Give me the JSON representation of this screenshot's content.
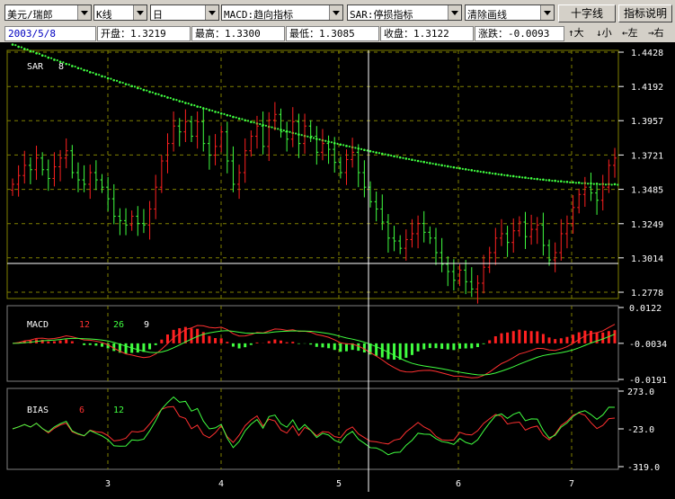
{
  "toolbar": {
    "symbol": "美元/瑞郎",
    "chart_type": "K线",
    "period": "日",
    "indicator1": "MACD:趋向指标",
    "indicator2": "SAR:停损指标",
    "draw_tool": "清除画线",
    "crosshair_btn": "十字线",
    "indicator_btn": "指标说明"
  },
  "info": {
    "date": "2003/5/8",
    "open": "开盘：1.3219",
    "high": "最高：1.3300",
    "low": "最低：1.3085",
    "close": "收盘：1.3122",
    "change": "涨跌：-0.0093",
    "nav_up": "↑大",
    "nav_down": "↓小",
    "nav_left": "←左",
    "nav_right": "→右"
  },
  "main_panel": {
    "label": "SAR",
    "param": "8",
    "y_ticks": [
      "1.4428",
      "1.4192",
      "1.3957",
      "1.3721",
      "1.3485",
      "1.3249",
      "1.3014",
      "1.2778"
    ]
  },
  "macd_panel": {
    "label": "MACD",
    "p1": "12",
    "p2": "26",
    "p3": "9",
    "y_ticks": [
      "0.0122",
      "-0.0034",
      "-0.0191"
    ]
  },
  "bias_panel": {
    "label": "BIAS",
    "p1": "6",
    "p2": "12",
    "y_ticks": [
      "273.0",
      "-23.0",
      "-319.0"
    ]
  },
  "x_axis": [
    "3",
    "4",
    "5",
    "6",
    "7"
  ],
  "colors": {
    "up": "#ff2020",
    "down": "#40ff40",
    "grid": "#808000",
    "axis_text": "#ffffff",
    "crosshair": "#ffffff"
  },
  "chart_data": {
    "type": "candlestick",
    "series_count": 102,
    "close": [
      1.352,
      1.358,
      1.365,
      1.362,
      1.37,
      1.362,
      1.356,
      1.364,
      1.37,
      1.375,
      1.36,
      1.355,
      1.352,
      1.36,
      1.355,
      1.35,
      1.342,
      1.33,
      1.327,
      1.324,
      1.33,
      1.325,
      1.324,
      1.335,
      1.35,
      1.368,
      1.38,
      1.392,
      1.388,
      1.395,
      1.385,
      1.395,
      1.38,
      1.372,
      1.378,
      1.388,
      1.368,
      1.352,
      1.36,
      1.375,
      1.385,
      1.392,
      1.378,
      1.396,
      1.4,
      1.388,
      1.383,
      1.395,
      1.38,
      1.392,
      1.385,
      1.374,
      1.38,
      1.376,
      1.367,
      1.36,
      1.369,
      1.374,
      1.36,
      1.35,
      1.34,
      1.335,
      1.326,
      1.315,
      1.313,
      1.308,
      1.314,
      1.318,
      1.325,
      1.319,
      1.315,
      1.305,
      1.297,
      1.292,
      1.286,
      1.293,
      1.285,
      1.28,
      1.284,
      1.295,
      1.305,
      1.315,
      1.318,
      1.312,
      1.32,
      1.326,
      1.316,
      1.321,
      1.324,
      1.31,
      1.3,
      1.305,
      1.318,
      1.325,
      1.336,
      1.345,
      1.35,
      1.346,
      1.341,
      1.35,
      1.365,
      1.37
    ],
    "sar_start": 1.448,
    "sar_end": 1.352
  }
}
